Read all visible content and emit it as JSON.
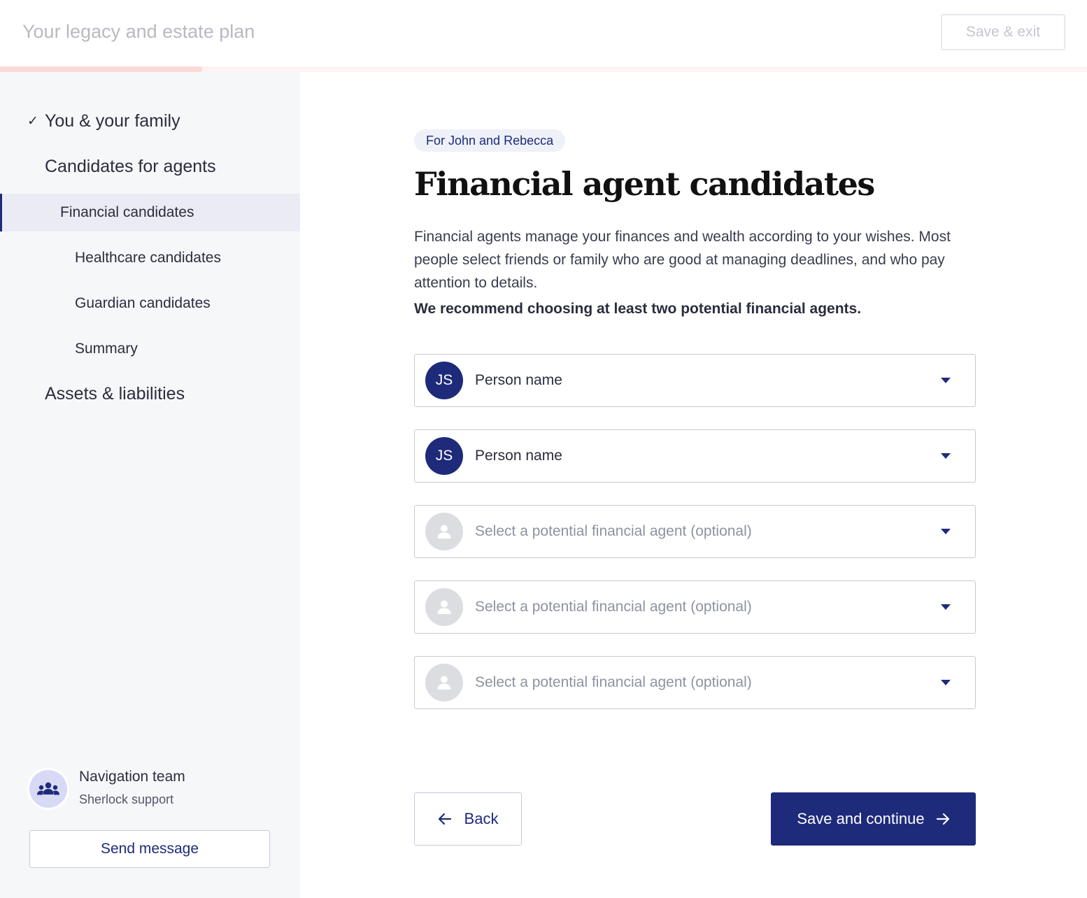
{
  "header": {
    "title": "Your legacy and estate plan",
    "save_exit_label": "Save & exit",
    "progress_fraction": 0.186,
    "accent_color": "#fbd9d6"
  },
  "sidebar": {
    "items": [
      {
        "label": "You & your family",
        "completed": true
      },
      {
        "label": "Candidates for agents"
      },
      {
        "label": "Financial candidates",
        "active": true
      },
      {
        "label": "Healthcare candidates"
      },
      {
        "label": "Guardian candidates"
      },
      {
        "label": "Summary"
      },
      {
        "label": "Assets & liabilities"
      }
    ],
    "check_glyph": "✓",
    "support": {
      "name": "Navigation team",
      "subtitle": "Sherlock support",
      "icon": "team-icon",
      "send_label": "Send message"
    }
  },
  "main": {
    "chip": "For John and Rebecca",
    "title": "Financial agent candidates",
    "description": "Financial agents manage your finances and wealth according to your wishes. Most people select friends or family who are good at managing deadlines, and who pay attention to details.",
    "recommendation": "We recommend choosing at least two potential financial agents.",
    "selects": [
      {
        "initials": "JS",
        "value": "Person name"
      },
      {
        "initials": "JS",
        "value": "Person name"
      },
      {
        "placeholder": "Select a potential financial agent (optional)"
      },
      {
        "placeholder": "Select a potential financial agent (optional)"
      },
      {
        "placeholder": "Select a potential financial agent (optional)"
      }
    ]
  },
  "footer": {
    "back_label": "Back",
    "continue_label": "Save and continue"
  },
  "colors": {
    "primary": "#1e2a7a",
    "sidebar_bg": "#f6f7f9",
    "active_item_bg": "#ebebf4"
  }
}
